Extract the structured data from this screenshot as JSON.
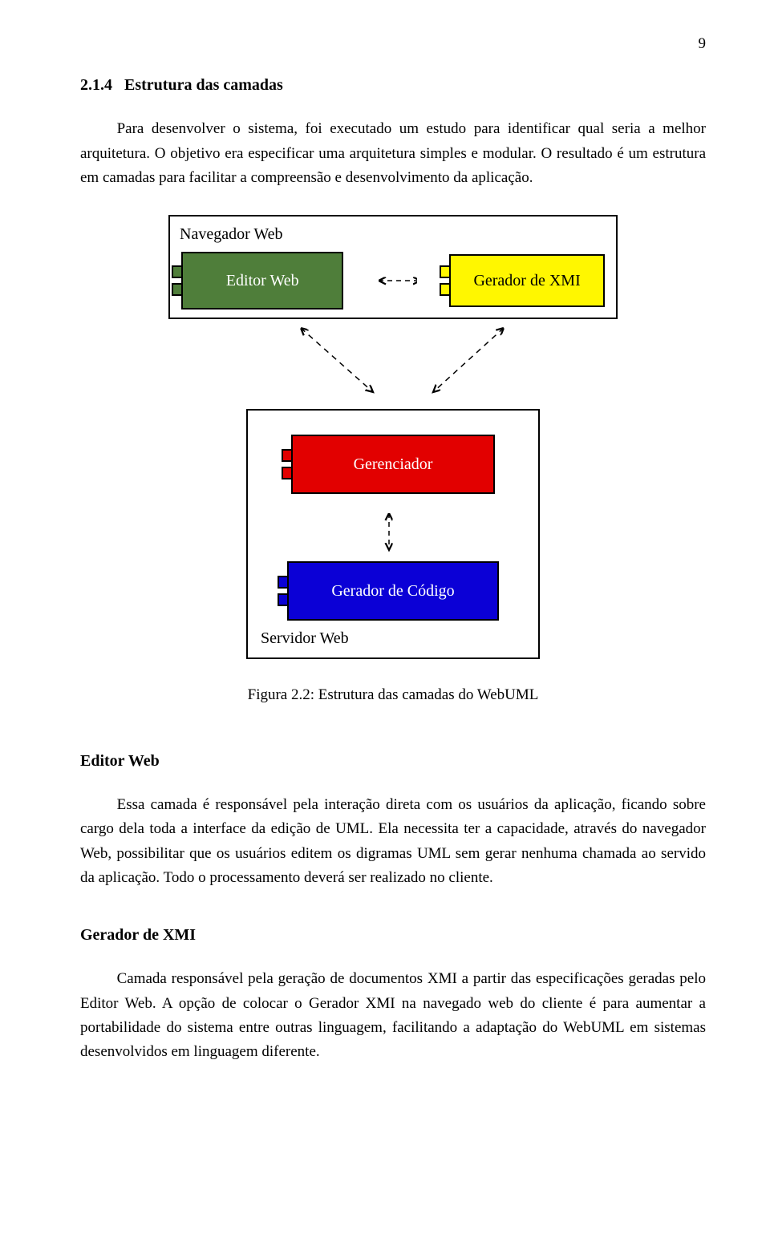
{
  "page_number": "9",
  "section": {
    "number": "2.1.4",
    "title": "Estrutura das camadas"
  },
  "para1": "Para desenvolver o sistema, foi executado um estudo para identificar qual seria a melhor arquitetura. O objetivo era especificar uma arquitetura simples e modular. O resultado é um estrutura em camadas para facilitar a compreensão e desenvolvimento da aplicação.",
  "diagram": {
    "browser_label": "Navegador Web",
    "editor_label": "Editor Web",
    "xmi_label": "Gerador de XMI",
    "manager_label": "Gerenciador",
    "codegen_label": "Gerador de Código",
    "server_label": "Servidor Web"
  },
  "figure_caption": "Figura 2.2: Estrutura das camadas do WebUML",
  "sub_a": {
    "title": "Editor Web",
    "text": "Essa camada é responsável pela interação direta com os usuários da aplicação, ficando sobre cargo dela toda a interface da edição de UML. Ela necessita ter a capacidade, através do navegador Web, possibilitar que os usuários editem os digramas UML sem gerar nenhuma chamada ao servido da aplicação. Todo o processamento deverá ser realizado no cliente."
  },
  "sub_b": {
    "title": "Gerador de XMI",
    "text": "Camada responsável pela geração de documentos XMI a partir das especificações geradas pelo Editor Web. A opção de colocar o Gerador XMI na navegado web do cliente é para aumentar a portabilidade do sistema entre outras linguagem, facilitando a adaptação do WebUML em sistemas desenvolvidos em linguagem diferente."
  }
}
